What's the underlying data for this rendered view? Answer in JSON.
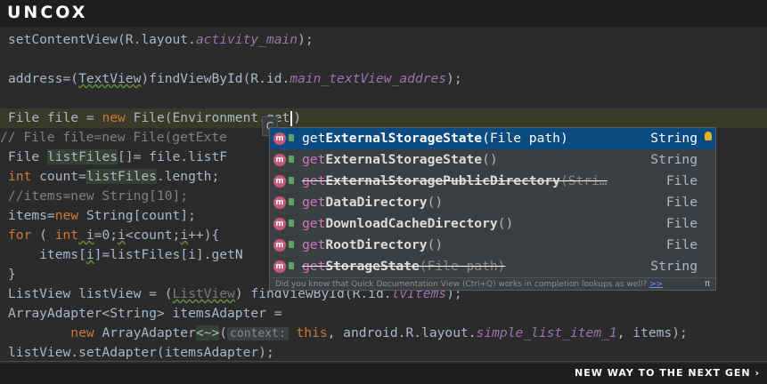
{
  "branding": {
    "logo": "UNCOX",
    "slogan": "NEW WAY TO THE NEXT GEN ›"
  },
  "code": {
    "l1": {
      "a": "setContentView(R.layout.",
      "b": "activity_main",
      "c": ");"
    },
    "l3": {
      "a": "address=(",
      "b": "TextView",
      "c": ")findViewById(R.id.",
      "d": "main_textView_addres",
      "e": ");"
    },
    "l5": {
      "a": "File file = ",
      "b": "new",
      "c": " File(Environment.",
      "d": "get",
      "e": ")"
    },
    "l6": {
      "a": "// File file=new File(getExte"
    },
    "l7": {
      "a": "File ",
      "b": "listFiles",
      "c": "[]= file.listF"
    },
    "l8": {
      "a": "int",
      "b": " count=",
      "c": "listFiles",
      "d": ".length;"
    },
    "l9": {
      "a": "//items=new String[10];"
    },
    "l10": {
      "a": "items=",
      "b": "new",
      "c": " String[count];"
    },
    "l11": {
      "a": "for",
      "b": " ( ",
      "c": "int",
      "d": " i",
      "e": "=0;",
      "f": "i",
      "g": "<count;",
      "h": "i",
      "i": "++){"
    },
    "l12": {
      "a": "    items[",
      "b": "i",
      "c": "]=listFiles[i].getN"
    },
    "l13": {
      "a": "}"
    },
    "l14": {
      "a": "ListView listView = (",
      "b": "ListView",
      "c": ") findViewById(R.id.",
      "d": "lvItems",
      "e": ");"
    },
    "l15": {
      "a": "ArrayAdapter<String> itemsAdapter ="
    },
    "l16": {
      "a": "        ",
      "b": "new",
      "c": " ArrayAdapter",
      "d": "<~>",
      "e": "(",
      "f": "context:",
      "g": " this",
      "h": ", android.R.layout.",
      "i": "simple_list_item_1",
      "j": ", items);"
    },
    "l17": {
      "a": "listView.setAdapter(itemsAdapter);"
    }
  },
  "tooltip_icon": "C",
  "completion": {
    "items": [
      {
        "prefix": "get",
        "rest": "ExternalStorageState",
        "args": "(File path)",
        "type": "String",
        "selected": true,
        "deprecated": false
      },
      {
        "prefix": "get",
        "rest": "ExternalStorageState",
        "args": "()",
        "type": "String",
        "selected": false,
        "deprecated": false
      },
      {
        "prefix": "get",
        "rest": "ExternalStoragePublicDirectory",
        "args": "(Stri…",
        "type": "File",
        "selected": false,
        "deprecated": true
      },
      {
        "prefix": "get",
        "rest": "DataDirectory",
        "args": "()",
        "type": "File",
        "selected": false,
        "deprecated": false
      },
      {
        "prefix": "get",
        "rest": "DownloadCacheDirectory",
        "args": "()",
        "type": "File",
        "selected": false,
        "deprecated": false
      },
      {
        "prefix": "get",
        "rest": "RootDirectory",
        "args": "()",
        "type": "File",
        "selected": false,
        "deprecated": false
      },
      {
        "prefix": "get",
        "rest": "StorageState",
        "args": "(File path)",
        "type": "String",
        "selected": false,
        "deprecated": true
      }
    ],
    "icon_letter": "m",
    "footer_text": "Did you know that Quick Documentation View (Ctrl+Q) works in completion lookups as well? ",
    "footer_link": ">>",
    "footer_pi": "π"
  }
}
